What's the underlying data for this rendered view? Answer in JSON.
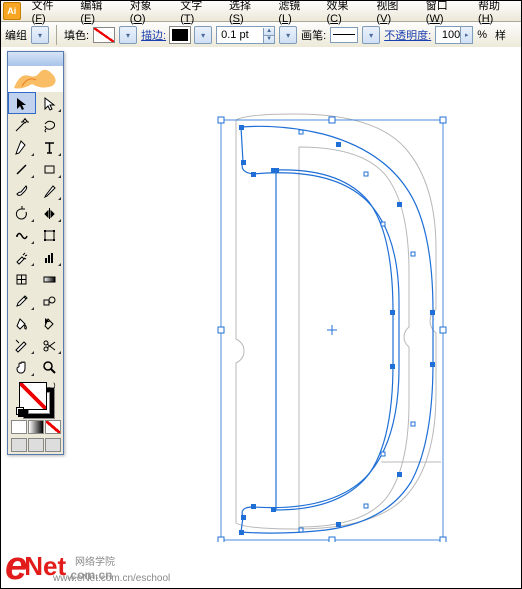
{
  "menu": {
    "items": [
      {
        "label": "文件",
        "u": "F"
      },
      {
        "label": "编辑",
        "u": "E"
      },
      {
        "label": "对象",
        "u": "O"
      },
      {
        "label": "文字",
        "u": "T"
      },
      {
        "label": "选择",
        "u": "S"
      },
      {
        "label": "滤镜",
        "u": "L"
      },
      {
        "label": "效果",
        "u": "C"
      },
      {
        "label": "视图",
        "u": "V"
      },
      {
        "label": "窗口",
        "u": "W"
      },
      {
        "label": "帮助",
        "u": "H"
      }
    ]
  },
  "ctrl": {
    "mode_label": "编组",
    "fill_label": "填色:",
    "stroke_label": "描边:",
    "stroke_weight": "0.1 pt",
    "brush_label": "画笔:",
    "opacity_label": "不透明度:",
    "opacity_value": "100",
    "opacity_percent": "%",
    "style_label_fragment": "样"
  },
  "tools": [
    {
      "name": "selection-tool",
      "sel": true
    },
    {
      "name": "direct-selection-tool",
      "tri": true
    },
    {
      "name": "magic-wand-tool"
    },
    {
      "name": "lasso-tool"
    },
    {
      "name": "pen-tool",
      "tri": true
    },
    {
      "name": "type-tool",
      "tri": true
    },
    {
      "name": "line-segment-tool",
      "tri": true
    },
    {
      "name": "rectangle-tool",
      "tri": true
    },
    {
      "name": "paintbrush-tool"
    },
    {
      "name": "pencil-tool",
      "tri": true
    },
    {
      "name": "rotate-tool",
      "tri": true
    },
    {
      "name": "reflect-tool",
      "tri": true
    },
    {
      "name": "warp-tool",
      "tri": true
    },
    {
      "name": "free-transform-tool"
    },
    {
      "name": "symbol-sprayer-tool",
      "tri": true
    },
    {
      "name": "column-graph-tool",
      "tri": true
    },
    {
      "name": "mesh-tool"
    },
    {
      "name": "gradient-tool"
    },
    {
      "name": "eyedropper-tool",
      "tri": true
    },
    {
      "name": "blend-tool"
    },
    {
      "name": "live-paint-bucket-tool"
    },
    {
      "name": "live-paint-selection-tool"
    },
    {
      "name": "slice-tool",
      "tri": true
    },
    {
      "name": "scissors-tool",
      "tri": true
    },
    {
      "name": "hand-tool",
      "tri": true
    },
    {
      "name": "zoom-tool"
    }
  ],
  "watermark": {
    "brand_e": "e",
    "brand_net": "Net",
    "brand_tld": ".com.cn",
    "tagline": "网络学院",
    "url": "www.eNet.com.cn/eschool"
  }
}
